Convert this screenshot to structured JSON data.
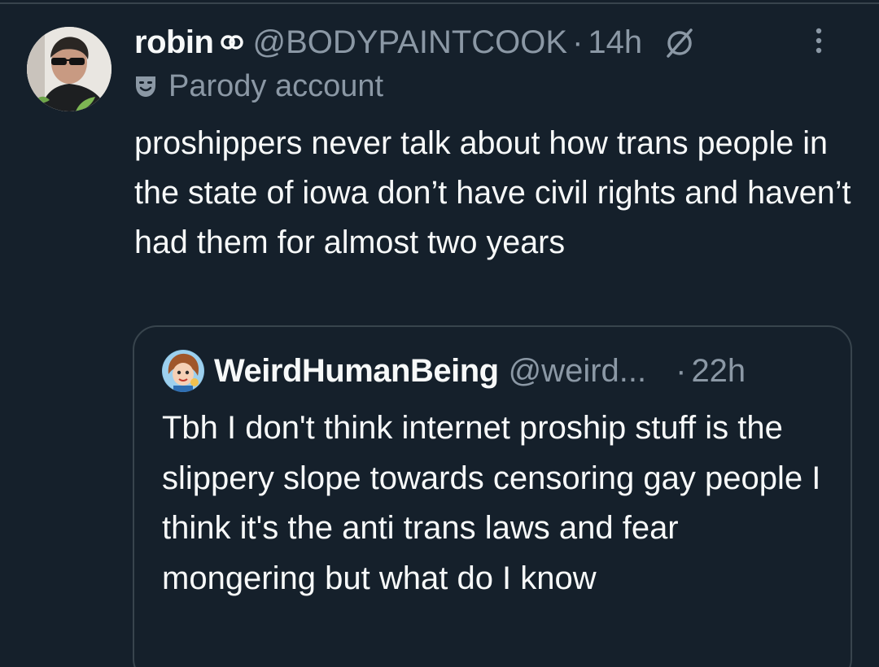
{
  "post": {
    "display_name": "robin",
    "affiliate_icon": "link-infinity-icon",
    "handle": "@BODYPAINTCOOK",
    "separator": "·",
    "time": "14h",
    "reply_restriction_icon": "restricted-circle-icon",
    "more_icon": "vertical-ellipsis-icon",
    "parody_icon": "theater-mask-icon",
    "parody_label": "Parody account",
    "text": "proshippers never talk about how trans people in the state of iowa don’t have civil rights and haven’t had them for almost two years"
  },
  "quote": {
    "display_name": "WeirdHumanBeing",
    "handle": "@weird...",
    "separator": "·",
    "time": "22h",
    "text": "Tbh I don't think internet proship stuff is the slippery slope towards censoring gay people I think it's the anti trans laws and fear mongering but what do I know"
  },
  "colors": {
    "background": "#15202b",
    "primary_text": "#f7f9f9",
    "secondary_text": "#8b98a5",
    "border": "#38444d"
  }
}
